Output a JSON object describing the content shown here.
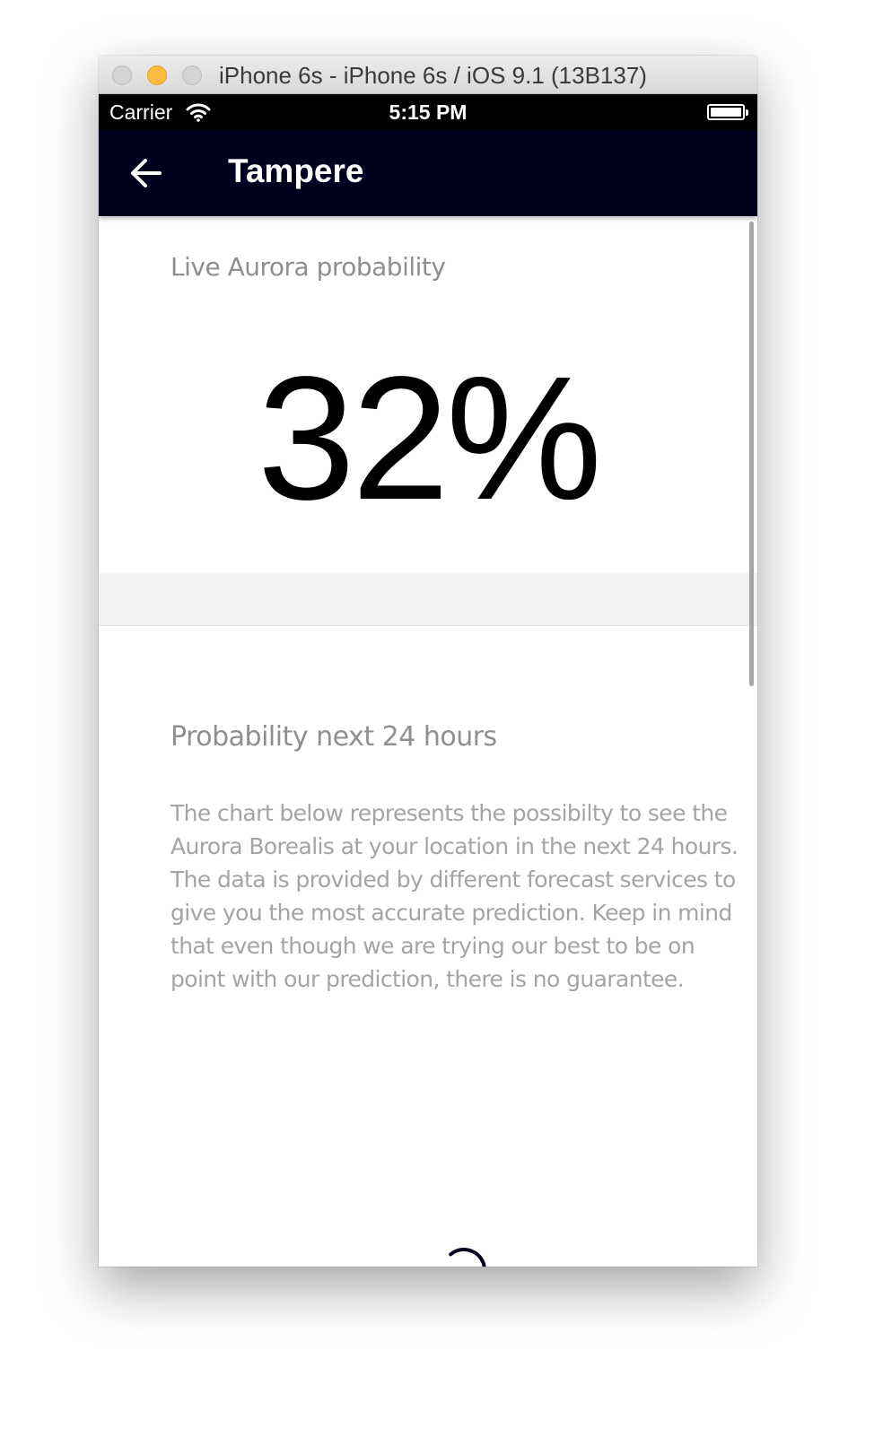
{
  "window": {
    "title": "iPhone 6s - iPhone 6s / iOS 9.1 (13B137)"
  },
  "status_bar": {
    "carrier": "Carrier",
    "time": "5:15 PM"
  },
  "app_bar": {
    "title": "Tampere",
    "back_icon": "arrow-left-icon"
  },
  "live_card": {
    "title": "Live Aurora probability",
    "probability": "32%"
  },
  "forecast": {
    "title": "Probability next 24 hours",
    "description": "The chart below represents the possibilty to see the Aurora Borealis at your location in the next 24 hours. The data is provided by different forecast services to give you the most accurate prediction. Keep in mind that even though we are trying our best to be on point with our prediction, there is no guarantee."
  },
  "colors": {
    "app_bar": "#00001c",
    "status_bar": "#000000",
    "heading_text": "#8f8f8f",
    "body_text": "#a4a4a4",
    "spinner": "#00001c",
    "minimize_button": "#fdbc40"
  }
}
